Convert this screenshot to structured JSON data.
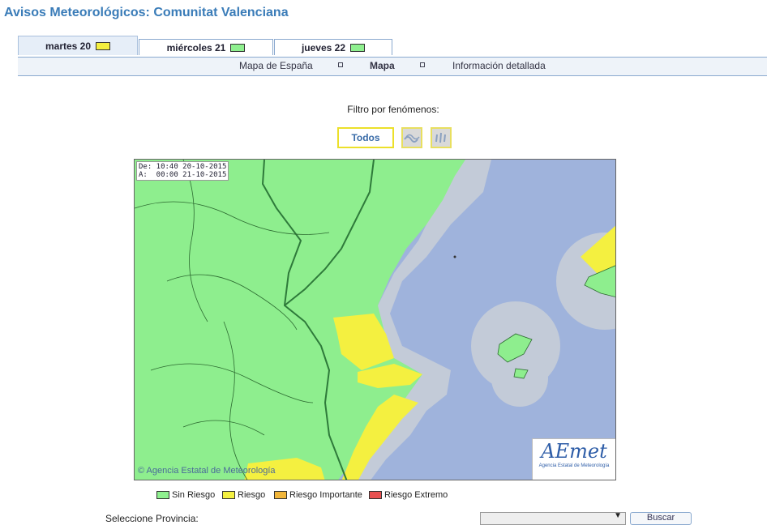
{
  "page": {
    "title": "Avisos Meteorológicos: Comunitat Valenciana"
  },
  "tabs": [
    {
      "label": "martes 20",
      "level_color": "#f4f040"
    },
    {
      "label": "miércoles 21",
      "level_color": "#8ff08f"
    },
    {
      "label": "jueves 22",
      "level_color": "#8ff08f"
    }
  ],
  "subnav": {
    "spain_map": "Mapa de España",
    "map": "Mapa",
    "detail": "Información detallada"
  },
  "filter": {
    "label": "Filtro por fenómenos:",
    "all": "Todos"
  },
  "map": {
    "from_label": "De: 10:40 20-10-2015",
    "to_label": "A:  00:00 21-10-2015",
    "copyright": "© Agencia Estatal de Meteorología",
    "logo_text": "AEmet",
    "logo_sub": "Agencia Estatal de Meteorología"
  },
  "legend": [
    {
      "label": "Sin Riesgo",
      "color": "#8ff08f"
    },
    {
      "label": "Riesgo",
      "color": "#f4f040"
    },
    {
      "label": "Riesgo Importante",
      "color": "#f2b63a"
    },
    {
      "label": "Riesgo Extremo",
      "color": "#e85050"
    }
  ],
  "footer": {
    "region_label": "Seleccione Provincia:",
    "search_button": "Buscar"
  }
}
